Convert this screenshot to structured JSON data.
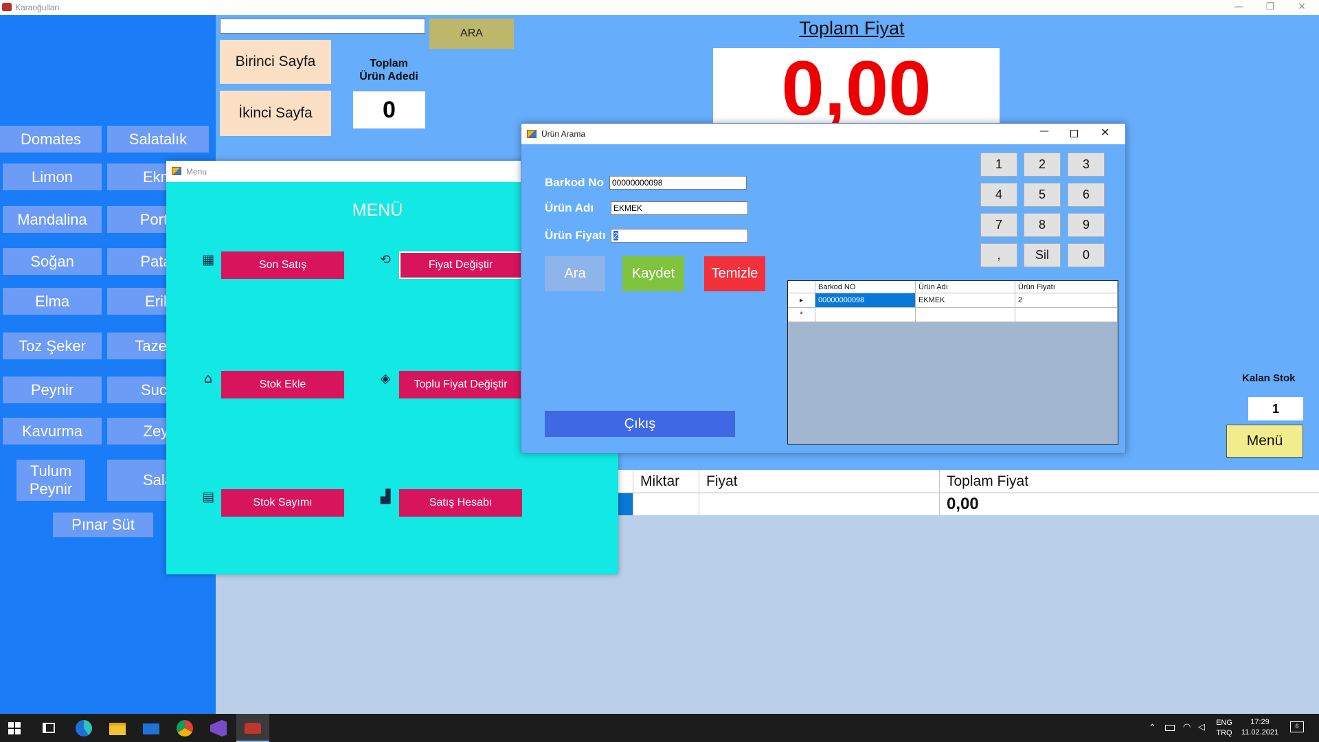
{
  "main_window": {
    "title": "Karaoğulları",
    "controls": [
      "—",
      "❐",
      "✕"
    ]
  },
  "products": [
    {
      "label": "Domates"
    },
    {
      "label": "Salatalık"
    },
    {
      "label": "Limon"
    },
    {
      "label": "Ekm"
    },
    {
      "label": "Mandalina"
    },
    {
      "label": "Porta"
    },
    {
      "label": "Soğan"
    },
    {
      "label": "Patat"
    },
    {
      "label": "Elma"
    },
    {
      "label": "Erik"
    },
    {
      "label": "Toz Şeker"
    },
    {
      "label": "Taze K"
    },
    {
      "label": "Peynir"
    },
    {
      "label": "Sucu"
    },
    {
      "label": "Kavurma"
    },
    {
      "label": "Zeyt"
    },
    {
      "label": "Tulum Peynir"
    },
    {
      "label": "Sala"
    },
    {
      "label": "Pınar Süt"
    }
  ],
  "search": {
    "value": "",
    "button_label": "ARA"
  },
  "pages": {
    "first": "Birinci  Sayfa",
    "second": "İkinci Sayfa"
  },
  "toplam_urun": {
    "label_line1": "Toplam",
    "label_line2": "Ürün Adedi",
    "value": "0"
  },
  "toplam_fiyat": {
    "label": "Toplam Fiyat",
    "value": "0,00",
    "value_color": "#ee0000"
  },
  "kalan_stok": {
    "label": "Kalan Stok",
    "value": "1"
  },
  "menu_button_label": "Menü",
  "main_grid": {
    "columns": [
      "Miktar",
      "Fiyat",
      "Toplam Fiyat"
    ],
    "row": {
      "miktar": "",
      "fiyat": "",
      "toplam": "0,00"
    }
  },
  "menu_window": {
    "title": "Menu",
    "heading": "MENÜ",
    "actions": [
      {
        "label": "Son Satış",
        "icon": "calculator-icon"
      },
      {
        "label": "Fiyat Değiştir",
        "icon": "refresh-icon"
      },
      {
        "label": "Stok Ekle",
        "icon": "factory-icon"
      },
      {
        "label": "Toplu Fiyat Değiştir",
        "icon": "price-tag-icon"
      },
      {
        "label": "Stok Sayımı",
        "icon": "spreadsheet-icon"
      },
      {
        "label": "Satış Hesabı",
        "icon": "bar-chart-icon"
      }
    ]
  },
  "urun_arama": {
    "title": "Ürün Arama",
    "fields": {
      "barkod_label": "Barkod No",
      "barkod_value": "00000000098",
      "urun_adi_label": "Ürün Adı",
      "urun_adi_value": "EKMEK",
      "urun_fiyati_label": "Ürün Fiyatı",
      "urun_fiyati_value": "2"
    },
    "buttons": {
      "ara": "Ara",
      "kaydet": "Kaydet",
      "temizle": "Temizle",
      "cikis": "Çıkış"
    },
    "keypad": [
      "1",
      "2",
      "3",
      "4",
      "5",
      "6",
      "7",
      "8",
      "9",
      ",",
      "Sil",
      "0"
    ],
    "grid": {
      "columns": [
        "Barkod NO",
        "Ürün Adı",
        "Ürün Fiyatı"
      ],
      "rows": [
        {
          "barkod": "00000000098",
          "urun_adi": "EKMEK",
          "fiyat": "2"
        }
      ],
      "row_markers": [
        "▸",
        "*"
      ]
    },
    "colors": {
      "ara": "#8fb4ea",
      "kaydet": "#7fc33f",
      "temizle": "#f3313d",
      "cikis": "#3f68e4"
    }
  },
  "taskbar": {
    "lang_line1": "ENG",
    "lang_line2": "TRQ",
    "time": "17:29",
    "date": "11.02.2021",
    "notification_count": "6",
    "apps": [
      "windows-start-icon",
      "task-view-icon",
      "edge-icon",
      "file-explorer-icon",
      "mail-icon",
      "chrome-icon",
      "visual-studio-icon",
      "karaogullari-app-icon"
    ]
  }
}
